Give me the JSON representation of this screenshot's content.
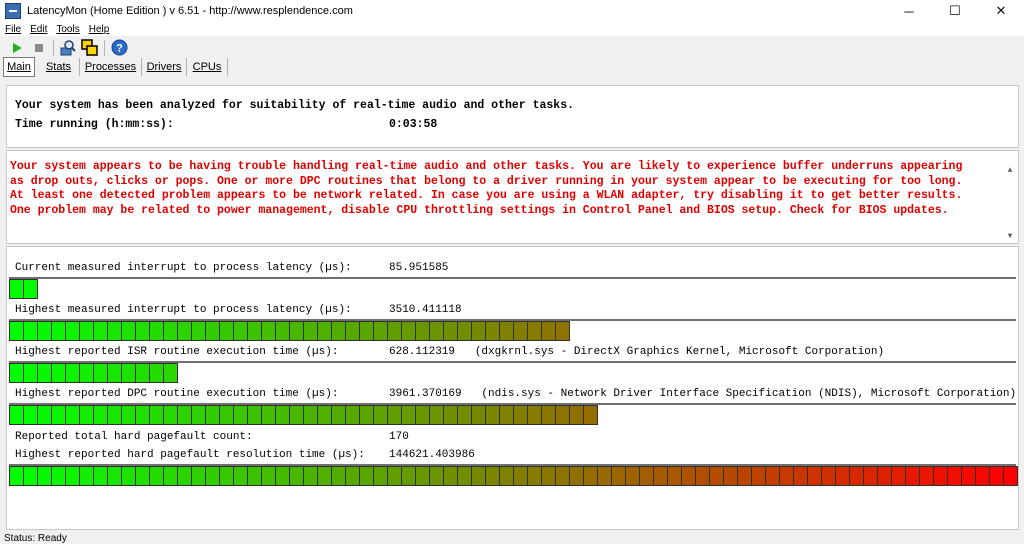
{
  "window": {
    "title": "LatencyMon  (Home Edition )  v 6.51 - http://www.resplendence.com",
    "minimize": "─",
    "maximize": "☐",
    "close": "✕"
  },
  "menu": [
    "File",
    "Edit",
    "Tools",
    "Help"
  ],
  "tabs": [
    "Main",
    "Stats",
    "Processes",
    "Drivers",
    "CPUs"
  ],
  "summary": {
    "line1": "Your system has been analyzed for suitability of real-time audio and other tasks.",
    "time_label": "Time running (h:mm:ss):",
    "time_value": "0:03:58"
  },
  "warning": {
    "line1": "Your system appears to be having trouble handling real-time audio and other tasks. You are likely to experience buffer underruns appearing",
    "line2": "as drop outs, clicks or pops. One or more DPC routines that belong to a driver running in your system appear to be executing for too long.",
    "line3": "At least one detected problem appears to be network related. In case you are using a WLAN adapter, try disabling it to get better results.",
    "line4": "One problem may be related to power management, disable CPU throttling settings in Control Panel and BIOS setup. Check for BIOS updates.",
    "color": "#e00000"
  },
  "metrics": [
    {
      "label": "Current measured interrupt to process latency (µs):",
      "value": "85.951585",
      "bar_level": 0.03
    },
    {
      "label": "Highest measured interrupt to process latency (µs):",
      "value": "3510.411118",
      "bar_level": 0.56
    },
    {
      "label": "Highest reported ISR routine execution time (µs):",
      "value": "628.112319   (dxgkrnl.sys - DirectX Graphics Kernel, Microsoft Corporation)",
      "bar_level": 0.17
    },
    {
      "label": "Highest reported DPC routine execution time (µs):",
      "value": "3961.370169   (ndis.sys - Network Driver Interface Specification (NDIS), Microsoft Corporation)",
      "bar_level": 0.58
    },
    {
      "label": "Reported total hard pagefault count:",
      "value": "170"
    },
    {
      "label": "Highest reported hard pagefault resolution time (µs):",
      "value": "144621.403986",
      "bar_level": 1.0
    }
  ],
  "status": {
    "text": "Status: Ready"
  },
  "colors": {
    "bar_start": "#00ff00",
    "bar_end": "#ff0000"
  }
}
